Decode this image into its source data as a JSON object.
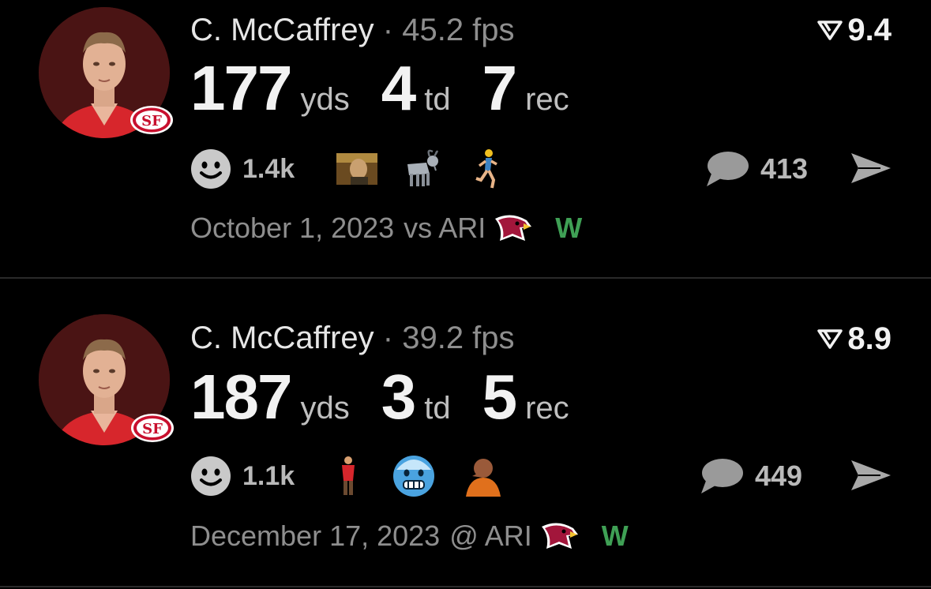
{
  "posts": [
    {
      "player": "C. McCaffrey",
      "separator": "·",
      "fps": "45.2 fps",
      "rating": "9.4",
      "stats": [
        {
          "value": "177",
          "unit": "yds"
        },
        {
          "value": "4",
          "unit": "td"
        },
        {
          "value": "7",
          "unit": "rec"
        }
      ],
      "reactions": {
        "count": "1.4k",
        "emojis": [
          "meme-image-icon",
          "goat-icon",
          "runner-icon"
        ]
      },
      "comments": "413",
      "game": {
        "date": "October 1, 2023",
        "matchup": "vs ARI",
        "opponent_logo": "cardinals-logo-icon",
        "result": "W"
      }
    },
    {
      "player": "C. McCaffrey",
      "separator": "·",
      "fps": "39.2 fps",
      "rating": "8.9",
      "stats": [
        {
          "value": "187",
          "unit": "yds"
        },
        {
          "value": "3",
          "unit": "td"
        },
        {
          "value": "5",
          "unit": "rec"
        }
      ],
      "reactions": {
        "count": "1.1k",
        "emojis": [
          "standing-person-icon",
          "cold-face-icon",
          "drake-meme-icon"
        ]
      },
      "comments": "449",
      "game": {
        "date": "December 17, 2023",
        "matchup": "@ ARI",
        "opponent_logo": "cardinals-logo-icon",
        "result": "W"
      }
    }
  ],
  "team_badge": "49ers-logo-icon",
  "colors": {
    "background": "#000000",
    "win": "#3fa055",
    "muted": "#8e8e8e",
    "avatar_bg": "#4a1414",
    "niners_red": "#c8102e"
  }
}
